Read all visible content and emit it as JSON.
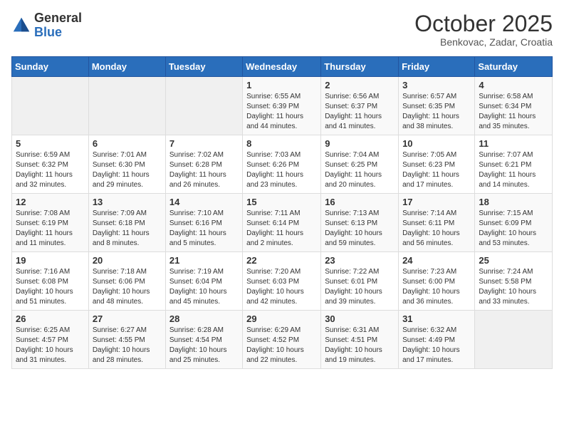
{
  "header": {
    "logo_general": "General",
    "logo_blue": "Blue",
    "month_title": "October 2025",
    "location": "Benkovac, Zadar, Croatia"
  },
  "days_of_week": [
    "Sunday",
    "Monday",
    "Tuesday",
    "Wednesday",
    "Thursday",
    "Friday",
    "Saturday"
  ],
  "weeks": [
    [
      {
        "day": "",
        "info": ""
      },
      {
        "day": "",
        "info": ""
      },
      {
        "day": "",
        "info": ""
      },
      {
        "day": "1",
        "info": "Sunrise: 6:55 AM\nSunset: 6:39 PM\nDaylight: 11 hours\nand 44 minutes."
      },
      {
        "day": "2",
        "info": "Sunrise: 6:56 AM\nSunset: 6:37 PM\nDaylight: 11 hours\nand 41 minutes."
      },
      {
        "day": "3",
        "info": "Sunrise: 6:57 AM\nSunset: 6:35 PM\nDaylight: 11 hours\nand 38 minutes."
      },
      {
        "day": "4",
        "info": "Sunrise: 6:58 AM\nSunset: 6:34 PM\nDaylight: 11 hours\nand 35 minutes."
      }
    ],
    [
      {
        "day": "5",
        "info": "Sunrise: 6:59 AM\nSunset: 6:32 PM\nDaylight: 11 hours\nand 32 minutes."
      },
      {
        "day": "6",
        "info": "Sunrise: 7:01 AM\nSunset: 6:30 PM\nDaylight: 11 hours\nand 29 minutes."
      },
      {
        "day": "7",
        "info": "Sunrise: 7:02 AM\nSunset: 6:28 PM\nDaylight: 11 hours\nand 26 minutes."
      },
      {
        "day": "8",
        "info": "Sunrise: 7:03 AM\nSunset: 6:26 PM\nDaylight: 11 hours\nand 23 minutes."
      },
      {
        "day": "9",
        "info": "Sunrise: 7:04 AM\nSunset: 6:25 PM\nDaylight: 11 hours\nand 20 minutes."
      },
      {
        "day": "10",
        "info": "Sunrise: 7:05 AM\nSunset: 6:23 PM\nDaylight: 11 hours\nand 17 minutes."
      },
      {
        "day": "11",
        "info": "Sunrise: 7:07 AM\nSunset: 6:21 PM\nDaylight: 11 hours\nand 14 minutes."
      }
    ],
    [
      {
        "day": "12",
        "info": "Sunrise: 7:08 AM\nSunset: 6:19 PM\nDaylight: 11 hours\nand 11 minutes."
      },
      {
        "day": "13",
        "info": "Sunrise: 7:09 AM\nSunset: 6:18 PM\nDaylight: 11 hours\nand 8 minutes."
      },
      {
        "day": "14",
        "info": "Sunrise: 7:10 AM\nSunset: 6:16 PM\nDaylight: 11 hours\nand 5 minutes."
      },
      {
        "day": "15",
        "info": "Sunrise: 7:11 AM\nSunset: 6:14 PM\nDaylight: 11 hours\nand 2 minutes."
      },
      {
        "day": "16",
        "info": "Sunrise: 7:13 AM\nSunset: 6:13 PM\nDaylight: 10 hours\nand 59 minutes."
      },
      {
        "day": "17",
        "info": "Sunrise: 7:14 AM\nSunset: 6:11 PM\nDaylight: 10 hours\nand 56 minutes."
      },
      {
        "day": "18",
        "info": "Sunrise: 7:15 AM\nSunset: 6:09 PM\nDaylight: 10 hours\nand 53 minutes."
      }
    ],
    [
      {
        "day": "19",
        "info": "Sunrise: 7:16 AM\nSunset: 6:08 PM\nDaylight: 10 hours\nand 51 minutes."
      },
      {
        "day": "20",
        "info": "Sunrise: 7:18 AM\nSunset: 6:06 PM\nDaylight: 10 hours\nand 48 minutes."
      },
      {
        "day": "21",
        "info": "Sunrise: 7:19 AM\nSunset: 6:04 PM\nDaylight: 10 hours\nand 45 minutes."
      },
      {
        "day": "22",
        "info": "Sunrise: 7:20 AM\nSunset: 6:03 PM\nDaylight: 10 hours\nand 42 minutes."
      },
      {
        "day": "23",
        "info": "Sunrise: 7:22 AM\nSunset: 6:01 PM\nDaylight: 10 hours\nand 39 minutes."
      },
      {
        "day": "24",
        "info": "Sunrise: 7:23 AM\nSunset: 6:00 PM\nDaylight: 10 hours\nand 36 minutes."
      },
      {
        "day": "25",
        "info": "Sunrise: 7:24 AM\nSunset: 5:58 PM\nDaylight: 10 hours\nand 33 minutes."
      }
    ],
    [
      {
        "day": "26",
        "info": "Sunrise: 6:25 AM\nSunset: 4:57 PM\nDaylight: 10 hours\nand 31 minutes."
      },
      {
        "day": "27",
        "info": "Sunrise: 6:27 AM\nSunset: 4:55 PM\nDaylight: 10 hours\nand 28 minutes."
      },
      {
        "day": "28",
        "info": "Sunrise: 6:28 AM\nSunset: 4:54 PM\nDaylight: 10 hours\nand 25 minutes."
      },
      {
        "day": "29",
        "info": "Sunrise: 6:29 AM\nSunset: 4:52 PM\nDaylight: 10 hours\nand 22 minutes."
      },
      {
        "day": "30",
        "info": "Sunrise: 6:31 AM\nSunset: 4:51 PM\nDaylight: 10 hours\nand 19 minutes."
      },
      {
        "day": "31",
        "info": "Sunrise: 6:32 AM\nSunset: 4:49 PM\nDaylight: 10 hours\nand 17 minutes."
      },
      {
        "day": "",
        "info": ""
      }
    ]
  ]
}
